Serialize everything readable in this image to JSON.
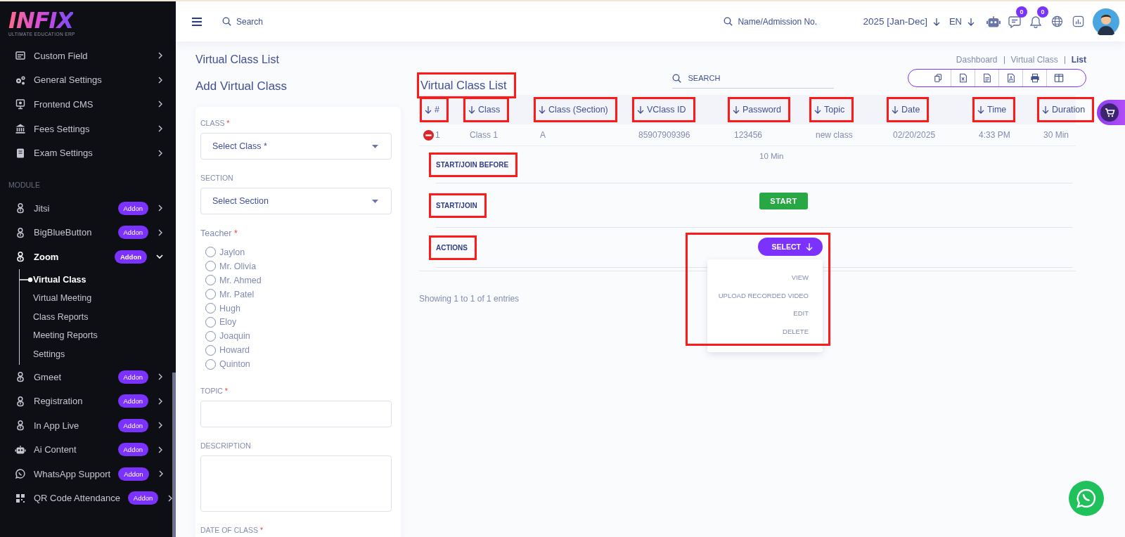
{
  "sidebar": {
    "logo": "INFIX",
    "logo_tagline": "ULTIMATE EDUCATION ERP",
    "items": [
      {
        "label": "Custom Field",
        "kind": "field"
      },
      {
        "label": "General Settings",
        "kind": "gears"
      },
      {
        "label": "Frontend CMS",
        "kind": "cms"
      },
      {
        "label": "Fees Settings",
        "kind": "bank"
      },
      {
        "label": "Exam Settings",
        "kind": "book"
      }
    ],
    "section_label": "MODULE",
    "modules": [
      {
        "label": "Jitsi",
        "kind": "person",
        "badge": "Addon",
        "selected": false,
        "expanded": false
      },
      {
        "label": "BigBlueButton",
        "kind": "person",
        "badge": "Addon",
        "selected": false,
        "expanded": false
      },
      {
        "label": "Zoom",
        "kind": "person",
        "badge": "Addon",
        "selected": true,
        "expanded": true,
        "children": [
          {
            "label": "Virtual Class",
            "selected": true
          },
          {
            "label": "Virtual Meeting",
            "selected": false
          },
          {
            "label": "Class Reports",
            "selected": false
          },
          {
            "label": "Meeting Reports",
            "selected": false
          },
          {
            "label": "Settings",
            "selected": false
          }
        ]
      },
      {
        "label": "Gmeet",
        "kind": "person",
        "badge": "Addon",
        "selected": false,
        "expanded": false
      },
      {
        "label": "Registration",
        "kind": "person",
        "badge": "Addon",
        "selected": false,
        "expanded": false
      },
      {
        "label": "In App Live",
        "kind": "person",
        "badge": "Addon",
        "selected": false,
        "expanded": false
      },
      {
        "label": "Ai Content",
        "kind": "robot",
        "badge": "Addon",
        "selected": false,
        "expanded": false
      },
      {
        "label": "WhatsApp Support",
        "kind": "whatsapp",
        "badge": "Addon",
        "selected": false,
        "expanded": false
      },
      {
        "label": "QR Code Attendance",
        "kind": "qr",
        "badge": "Addon",
        "selected": false,
        "expanded": false
      }
    ]
  },
  "topbar": {
    "search_placeholder": "Search",
    "admission_placeholder": "Name/Admission No.",
    "session": "2025 [Jan-Dec]",
    "language": "EN",
    "messages_count": "0",
    "notifications_count": "0"
  },
  "page": {
    "title": "Virtual Class List",
    "breadcrumb": [
      {
        "label": "Dashboard",
        "selected": false
      },
      {
        "label": "Virtual Class",
        "selected": false
      },
      {
        "label": "List",
        "selected": true
      }
    ]
  },
  "form": {
    "title": "Add Virtual Class",
    "fields": [
      {
        "kind": "select",
        "label": "CLASS",
        "required_mark": "*",
        "placeholder": "Select Class *"
      },
      {
        "kind": "select",
        "label": "SECTION",
        "placeholder": "Select Section"
      },
      {
        "kind": "radio",
        "label": "Teacher",
        "required_mark": "*",
        "options": [
          {
            "label": "Jaylon",
            "selected": false
          },
          {
            "label": "Mr. Olivia",
            "selected": false
          },
          {
            "label": "Mr. Ahmed",
            "selected": false
          },
          {
            "label": "Mr. Patel",
            "selected": false
          },
          {
            "label": "Hugh",
            "selected": false
          },
          {
            "label": "Eloy",
            "selected": false
          },
          {
            "label": "Joaquin",
            "selected": false
          },
          {
            "label": "Howard",
            "selected": false
          },
          {
            "label": "Quinton",
            "selected": false
          }
        ]
      },
      {
        "kind": "text",
        "label": "TOPIC",
        "required_mark": "*"
      },
      {
        "kind": "textarea",
        "label": "DESCRIPTION"
      },
      {
        "kind": "label_only",
        "label": "DATE OF CLASS",
        "required_mark": "*"
      }
    ]
  },
  "list": {
    "title": "Virtual Class List",
    "title_highlighted": true,
    "search_placeholder": "SEARCH",
    "export_buttons": [
      {
        "kind": "copy"
      },
      {
        "kind": "excel"
      },
      {
        "kind": "csv"
      },
      {
        "kind": "pdf"
      },
      {
        "kind": "print"
      },
      {
        "kind": "columns"
      }
    ],
    "columns": [
      {
        "label": "#",
        "highlighted": true
      },
      {
        "label": "Class",
        "highlighted": true
      },
      {
        "label": "Class (Section)",
        "highlighted": true
      },
      {
        "label": "VClass ID",
        "highlighted": true
      },
      {
        "label": "Password",
        "highlighted": true
      },
      {
        "label": "Topic",
        "highlighted": true
      },
      {
        "label": "Date",
        "highlighted": true
      },
      {
        "label": "Time",
        "highlighted": true
      },
      {
        "label": "Duration",
        "highlighted": true
      }
    ],
    "rows": [
      {
        "expanded": true,
        "cells": [
          "1",
          "Class 1",
          "A",
          "85907909396",
          "123456",
          "new class",
          "02/20/2025",
          "4:33 PM",
          "30 Min"
        ],
        "details": [
          {
            "kind": "text",
            "label": "START/JOIN BEFORE",
            "highlighted": true,
            "value": "10 Min"
          },
          {
            "kind": "button",
            "label": "START/JOIN",
            "highlighted": true,
            "value": "START"
          },
          {
            "kind": "menu",
            "label": "ACTIONS",
            "highlighted": true,
            "value": "SELECT",
            "open": true,
            "menu_highlighted": true,
            "options": [
              "VIEW",
              "UPLOAD RECORDED VIDEO",
              "EDIT",
              "DELETE"
            ]
          }
        ]
      }
    ],
    "footer": "Showing 1 to 1 of 1 entries"
  }
}
